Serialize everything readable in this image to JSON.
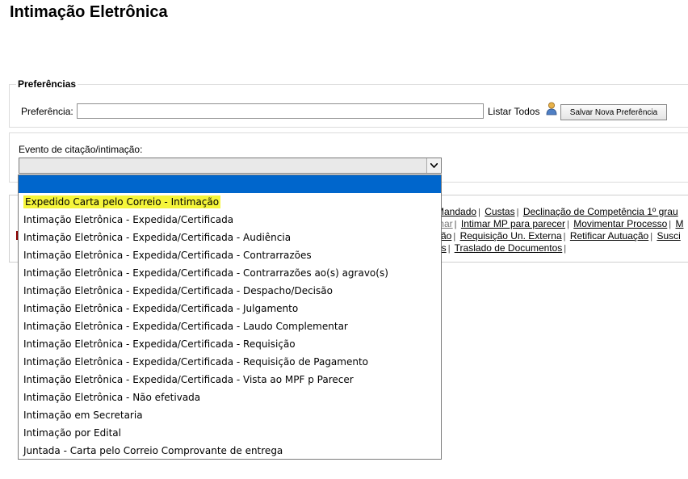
{
  "page": {
    "title": "Intimação Eletrônica"
  },
  "preferences": {
    "legend": "Preferências",
    "label": "Preferência:",
    "input_value": "",
    "list_all": "Listar Todos",
    "save_button": "Salvar Nova Preferência"
  },
  "event": {
    "label": "Evento de citação/intimação:",
    "selected": "",
    "options": [
      "Expedido Carta pelo Correio - Intimação",
      "Intimação Eletrônica - Expedida/Certificada",
      "Intimação Eletrônica - Expedida/Certificada - Audiência",
      "Intimação Eletrônica - Expedida/Certificada - Contrarrazões",
      "Intimação Eletrônica - Expedida/Certificada - Contrarrazões ao(s) agravo(s)",
      "Intimação Eletrônica - Expedida/Certificada - Despacho/Decisão",
      "Intimação Eletrônica - Expedida/Certificada - Julgamento",
      "Intimação Eletrônica - Expedida/Certificada - Laudo Complementar",
      "Intimação Eletrônica - Expedida/Certificada - Requisição",
      "Intimação Eletrônica - Expedida/Certificada - Requisição de Pagamento",
      "Intimação Eletrônica - Expedida/Certificada - Vista ao MPF p Parecer",
      "Intimação Eletrônica - Não efetivada",
      "Intimação em Secretaria",
      "Intimação por Edital",
      "Juntada - Carta pelo Correio Comprovante de entrega"
    ]
  },
  "actions": {
    "row1": [
      "Mandado",
      "Custas",
      "Declinação de Competência 1º grau"
    ],
    "row2": [
      "mar",
      "Intimar MP para parecer",
      "Movimentar Processo",
      "M"
    ],
    "row3": [
      "ção",
      "Requisição Un. Externa",
      "Retificar Autuação",
      "Susci"
    ],
    "row4": [
      "os",
      "Traslado de Documentos"
    ]
  },
  "icons": {
    "user": "user-icon",
    "dropdown_arrow": "chevron-down-icon"
  },
  "colors": {
    "highlight": "#f5f53a",
    "selection": "#0066cc"
  }
}
